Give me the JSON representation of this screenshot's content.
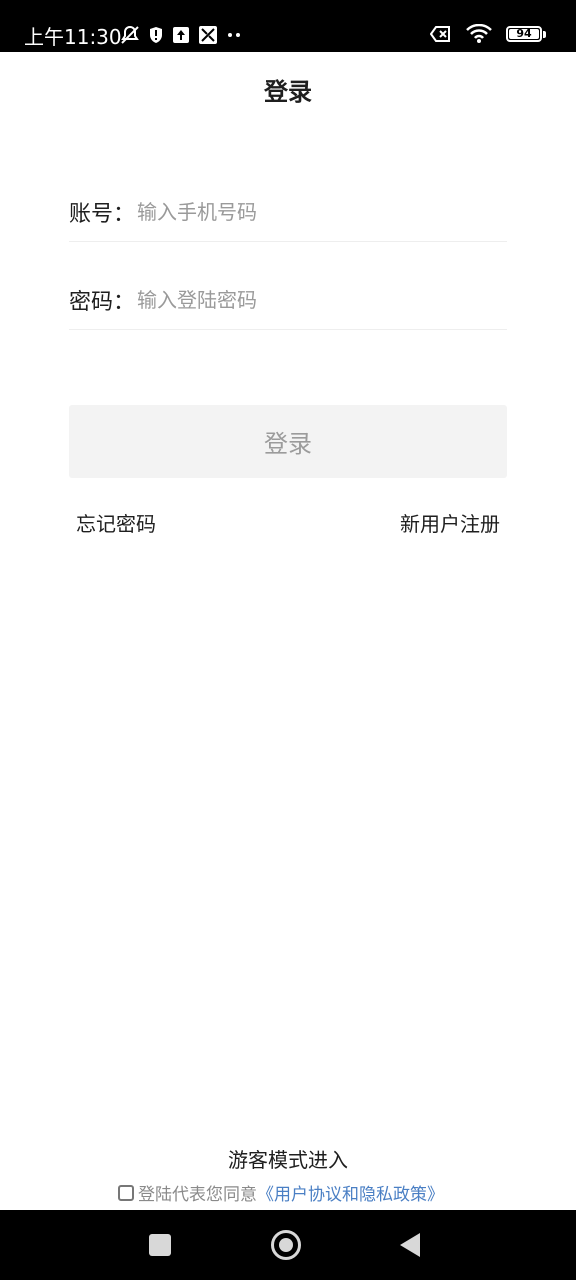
{
  "status_bar": {
    "time": "上午11:30",
    "icons_left": [
      "muted-bell-icon",
      "shield-alert-icon",
      "upload-icon",
      "app-icon",
      "more-dots-icon"
    ],
    "icons_right": [
      "sim-off-icon",
      "wifi-icon"
    ],
    "battery_level": "94"
  },
  "header": {
    "title": "登录"
  },
  "form": {
    "account_label": "账号：",
    "account_placeholder": "输入手机号码",
    "password_label": "密码：",
    "password_placeholder": "输入登陆密码"
  },
  "login_button_label": "登录",
  "links": {
    "forgot_password": "忘记密码",
    "register": "新用户注册"
  },
  "footer": {
    "guest_entry": "游客模式进入",
    "agreement_prefix": "登陆代表您同意",
    "agreement_link": "《用户协议和隐私政策》"
  },
  "nav_bar": {
    "icons": [
      "recent-apps-icon",
      "home-icon",
      "back-icon"
    ]
  },
  "colors": {
    "link": "#4a7fc4",
    "button_bg": "#f3f3f3",
    "button_text": "#9b9b9b"
  }
}
